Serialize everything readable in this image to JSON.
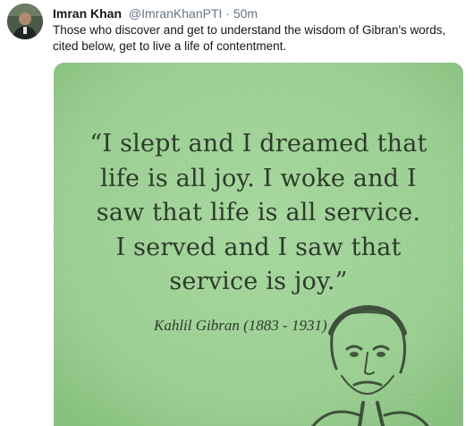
{
  "tweet": {
    "author_name": "Imran Khan",
    "author_handle": "@ImranKhanPTI",
    "separator": "·",
    "time": "50m",
    "text": "Those who discover and get to understand the wisdom of Gibran's words, cited below, get to live a life of contentment."
  },
  "media": {
    "quote_lines": [
      "“I slept and I dreamed that",
      "life is all joy. I woke and I",
      "saw that life is all service.",
      "I served and I saw that",
      "service is joy.”"
    ],
    "attribution": "Kahlil Gibran (1883 - 1931)",
    "background_color": "#9fd197",
    "text_color": "#2e3a2d"
  },
  "colors": {
    "name": "#14171a",
    "secondary": "#657786"
  }
}
